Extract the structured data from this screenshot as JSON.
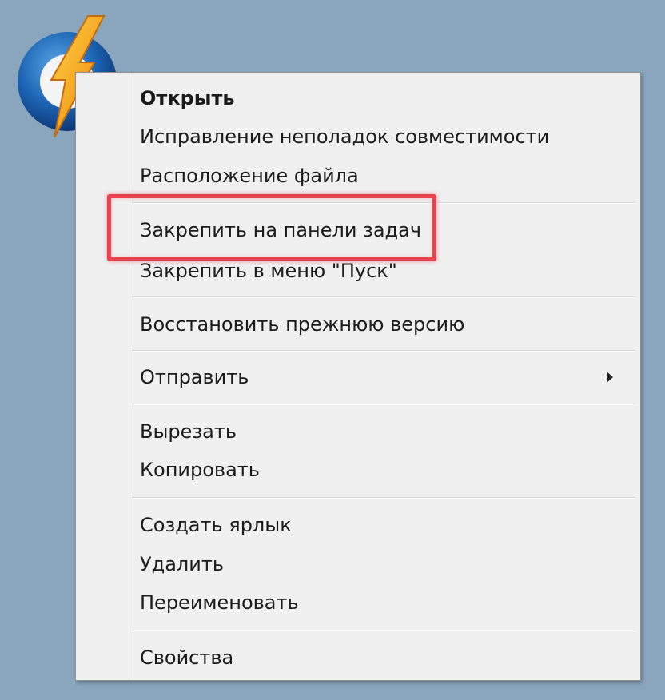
{
  "desktop": {
    "background_color": "#8aa6bd",
    "shortcut_icon": "lightning-bolt-icon"
  },
  "context_menu": {
    "items": [
      {
        "label": "Открыть",
        "bold": true
      },
      {
        "label": "Исправление неполадок совместимости"
      },
      {
        "label": "Расположение файла"
      },
      {
        "label": "Закрепить на панели задач"
      },
      {
        "label": "Закрепить в меню \"Пуск\""
      },
      {
        "label": "Восстановить прежнюю версию"
      },
      {
        "label": "Отправить",
        "submenu": true
      },
      {
        "label": "Вырезать"
      },
      {
        "label": "Копировать"
      },
      {
        "label": "Создать ярлык"
      },
      {
        "label": "Удалить"
      },
      {
        "label": "Переименовать"
      },
      {
        "label": "Свойства"
      }
    ]
  },
  "highlight": {
    "color": "#e8424e",
    "target": "Закрепить на панели задач"
  }
}
